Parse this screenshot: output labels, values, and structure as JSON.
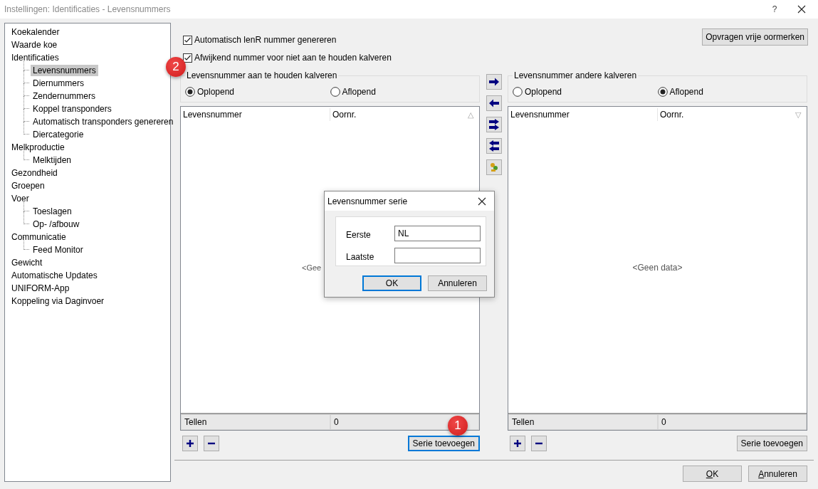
{
  "window": {
    "title": "Instellingen:  Identificaties - Levensnummers",
    "help": "?"
  },
  "nav_tree": [
    {
      "label": "Koekalender",
      "selected": false
    },
    {
      "label": "Waarde koe",
      "selected": false
    },
    {
      "label": "Identificaties",
      "selected": false,
      "children": [
        {
          "label": "Levensnummers",
          "selected": true
        },
        {
          "label": "Diernummers",
          "selected": false
        },
        {
          "label": "Zendernummers",
          "selected": false
        },
        {
          "label": "Koppel transponders",
          "selected": false
        },
        {
          "label": "Automatisch transponders genereren",
          "selected": false
        },
        {
          "label": "Diercategorie",
          "selected": false
        }
      ]
    },
    {
      "label": "Melkproductie",
      "selected": false,
      "children": [
        {
          "label": "Melktijden",
          "selected": false
        }
      ]
    },
    {
      "label": "Gezondheid",
      "selected": false
    },
    {
      "label": "Groepen",
      "selected": false
    },
    {
      "label": "Voer",
      "selected": false,
      "children": [
        {
          "label": "Toeslagen",
          "selected": false
        },
        {
          "label": "Op- /afbouw",
          "selected": false
        }
      ]
    },
    {
      "label": "Communicatie",
      "selected": false,
      "children": [
        {
          "label": "Feed Monitor",
          "selected": false
        }
      ]
    },
    {
      "label": "Gewicht",
      "selected": false
    },
    {
      "label": "Automatische Updates",
      "selected": false
    },
    {
      "label": "UNIFORM-App",
      "selected": false
    },
    {
      "label": "Koppeling via Daginvoer",
      "selected": false
    }
  ],
  "options": [
    {
      "label": "Automatisch lenR nummer genereren",
      "checked": true
    },
    {
      "label": "Afwijkend nummer voor niet aan te houden kalveren",
      "checked": true,
      "badge": "2"
    }
  ],
  "request_button": "Opvragen vrije oormerken",
  "panels": [
    {
      "group_title": "Levensnummer aan te houden kalveren",
      "radios": [
        {
          "label": "Oplopend",
          "selected": true
        },
        {
          "label": "Aflopend",
          "selected": false
        }
      ],
      "columns": [
        "Levensnummer",
        "Oornr."
      ],
      "sort_mark": "△",
      "empty_text": "<Gee",
      "footer": [
        "Tellen",
        "0"
      ],
      "series_button": {
        "label": "Serie toevoegen",
        "focused": true,
        "badge": "1"
      }
    },
    {
      "group_title": "Levensnummer andere kalveren",
      "radios": [
        {
          "label": "Oplopend",
          "selected": false
        },
        {
          "label": "Aflopend",
          "selected": true
        }
      ],
      "columns": [
        "Levensnummer",
        "Oornr."
      ],
      "sort_mark": "▽",
      "empty_text": "<Geen data>",
      "footer": [
        "Tellen",
        "0"
      ],
      "series_button": {
        "label": "Serie toevoegen",
        "focused": false
      }
    }
  ],
  "dialog": {
    "title": "Levensnummer serie",
    "fields": [
      {
        "label": "Eerste",
        "value": "NL "
      },
      {
        "label": "Laatste"
      }
    ],
    "buttons": [
      {
        "label": "OK",
        "default": true
      },
      {
        "label": "Annuleren",
        "default": false
      }
    ]
  },
  "footer_buttons": [
    "OK",
    "Annuleren"
  ]
}
